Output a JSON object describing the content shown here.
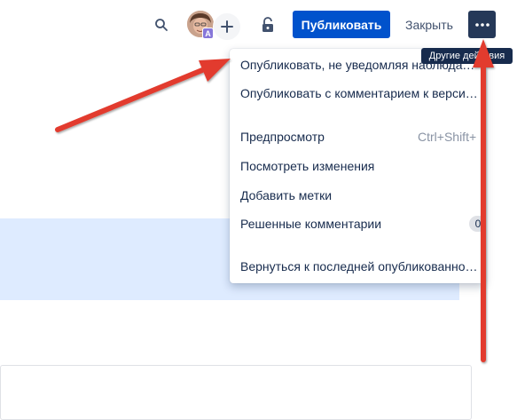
{
  "toolbar": {
    "search_icon": "search-icon",
    "avatar_badge": "A",
    "add_people_symbol": "+",
    "lock_icon": "unlock-icon",
    "publish_label": "Публиковать",
    "close_label": "Закрыть",
    "more_symbol": "···",
    "more_tooltip": "Другие действия"
  },
  "menu": {
    "items": [
      {
        "label": "Опубликовать, не уведомляя наблюдате..."
      },
      {
        "label": "Опубликовать с комментарием к версии..."
      },
      {
        "label": "Предпросмотр",
        "shortcut": "Ctrl+Shift+"
      },
      {
        "label": "Посмотреть изменения"
      },
      {
        "label": "Добавить метки"
      },
      {
        "label": "Решенные комментарии",
        "count": "0"
      },
      {
        "label": "Вернуться к последней опубликованной ..."
      }
    ]
  },
  "colors": {
    "publish_bg": "#0052cc",
    "more_bg": "#253858",
    "highlight_bg": "#deebff",
    "annotation_arrow": "#e23b2e"
  }
}
